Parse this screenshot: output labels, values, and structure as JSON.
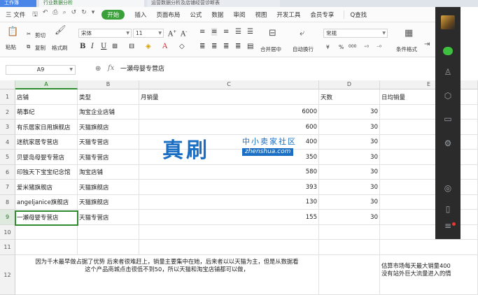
{
  "tabs": [
    "工作簿",
    "行业数据分析",
    "运营数据分析及店铺经营诊断表"
  ],
  "menu": {
    "file": "三 文件",
    "start": "开始",
    "items": [
      "插入",
      "页面布局",
      "公式",
      "数据",
      "审阅",
      "视图",
      "开发工具",
      "会员专享"
    ],
    "search": "Q查找"
  },
  "ribbon": {
    "paste": "粘贴",
    "cut": "剪切",
    "copy": "复制",
    "format_painter": "格式刷",
    "font_name": "宋体",
    "font_size": "11",
    "merge_center": "合并居中",
    "auto_wrap": "自动换行",
    "number_format": "常规",
    "currency": "¥",
    "percent": "%",
    "thousands": "000",
    "cond_format": "条件格式"
  },
  "formula_bar": {
    "cell_ref": "A9",
    "fx": "fx",
    "value": "一瀬母婴专营店"
  },
  "columns": [
    "A",
    "B",
    "C",
    "D",
    "E"
  ],
  "rows": [
    {
      "n": "1",
      "a": "店铺",
      "b": "类型",
      "c": "月销量",
      "d": "天数",
      "e": "日均销量"
    },
    {
      "n": "2",
      "a": "萌事纪",
      "b": "淘宝企业店铺",
      "c": "6000",
      "d": "30",
      "e": ""
    },
    {
      "n": "3",
      "a": "有乐居家日用旗舰店",
      "b": "天猫旗舰店",
      "c": "600",
      "d": "30",
      "e": ""
    },
    {
      "n": "4",
      "a": "迷航家居专营店",
      "b": "天猫专营店",
      "c": "400",
      "d": "30",
      "e": ""
    },
    {
      "n": "5",
      "a": "贝婴岛母婴专营店",
      "b": "天猫专营店",
      "c": "350",
      "d": "30",
      "e": ""
    },
    {
      "n": "6",
      "a": "印独天下宝宝纪念馆",
      "b": "淘宝店铺",
      "c": "580",
      "d": "30",
      "e": ""
    },
    {
      "n": "7",
      "a": "爱米猪旗舰店",
      "b": "天猫旗舰店",
      "c": "393",
      "d": "30",
      "e": ""
    },
    {
      "n": "8",
      "a": "angeljanice旗舰店",
      "b": "天猫旗舰店",
      "c": "130",
      "d": "30",
      "e": ""
    },
    {
      "n": "9",
      "a": "一瀬母婴专营店",
      "b": "天猫专营店",
      "c": "155",
      "d": "30",
      "e": ""
    },
    {
      "n": "10",
      "a": "",
      "b": "",
      "c": "",
      "d": "",
      "e": ""
    },
    {
      "n": "11",
      "a": "",
      "b": "",
      "c": "",
      "d": "",
      "e": ""
    }
  ],
  "row12": {
    "n": "12",
    "note": "因为千木最早做占据了优势 后来者很难赶上，销量主要集中在她，后来者以以天猫为主，但是从数据看\n这个产品商城点击很低不到50，所以天猫和淘宝店铺都可以做，",
    "note_e": "估算市场每天最大销量400\n没有站外巨大流量进入的情"
  },
  "watermark": {
    "big": "真刷",
    "small": "中小卖家社区",
    "domain": "zhenshua.com"
  }
}
